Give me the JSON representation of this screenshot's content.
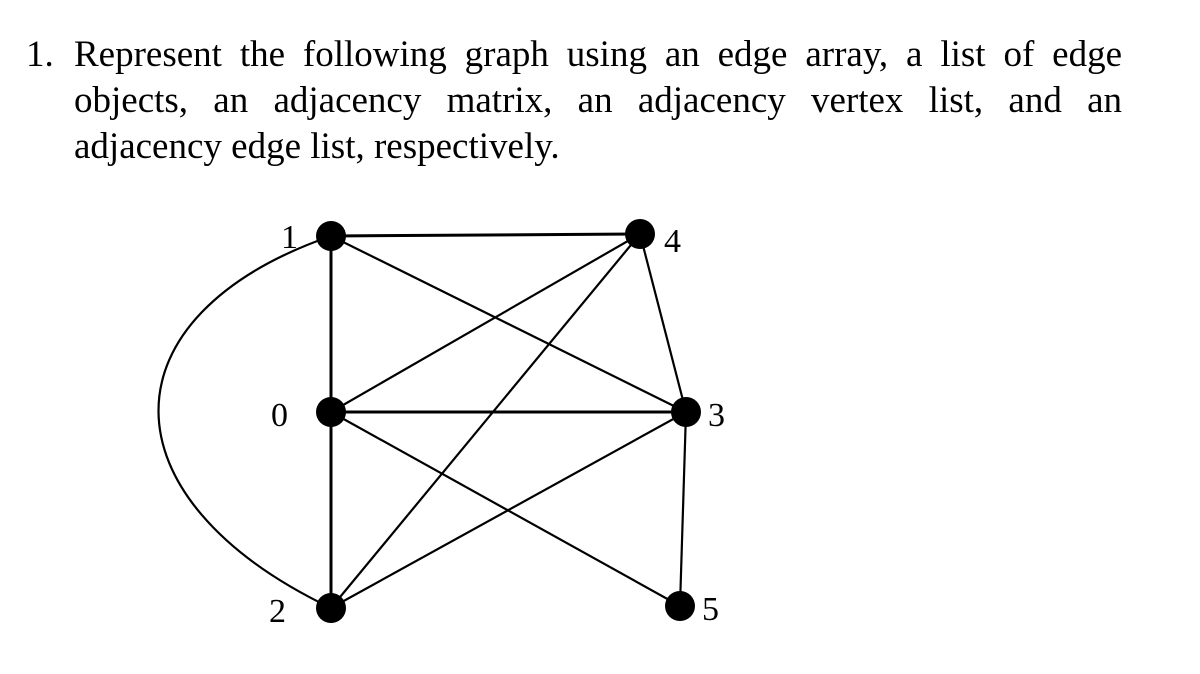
{
  "question": {
    "number": "1.",
    "lines": [
      "Represent the following graph using an edge array, a list of edge",
      "objects, an adjacency matrix, an adjacency vertex list, and an",
      "adjacency edge list, respectively."
    ]
  },
  "graph": {
    "type": "undirected",
    "vertices": [
      {
        "id": "0",
        "label": "0"
      },
      {
        "id": "1",
        "label": "1"
      },
      {
        "id": "2",
        "label": "2"
      },
      {
        "id": "3",
        "label": "3"
      },
      {
        "id": "4",
        "label": "4"
      },
      {
        "id": "5",
        "label": "5"
      }
    ],
    "edges": [
      {
        "u": "1",
        "v": "4"
      },
      {
        "u": "1",
        "v": "0"
      },
      {
        "u": "1",
        "v": "3"
      },
      {
        "u": "1",
        "v": "2",
        "style": "curved"
      },
      {
        "u": "4",
        "v": "0"
      },
      {
        "u": "4",
        "v": "2"
      },
      {
        "u": "4",
        "v": "3"
      },
      {
        "u": "0",
        "v": "3"
      },
      {
        "u": "0",
        "v": "2"
      },
      {
        "u": "0",
        "v": "5"
      },
      {
        "u": "3",
        "v": "2"
      },
      {
        "u": "3",
        "v": "5"
      }
    ]
  }
}
